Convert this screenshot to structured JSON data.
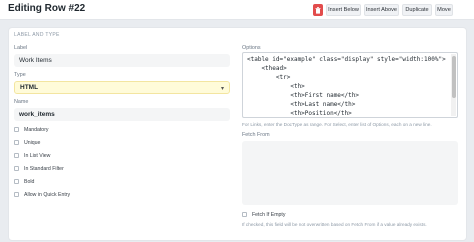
{
  "header": {
    "title": "Editing Row #22",
    "buttons": {
      "insert_below": "Insert Below",
      "insert_above": "Insert Above",
      "duplicate": "Duplicate",
      "move": "Move"
    }
  },
  "section": {
    "title": "LABEL AND TYPE"
  },
  "left": {
    "label": {
      "label": "Label",
      "value": "Work Items"
    },
    "type": {
      "label": "Type",
      "value": "HTML"
    },
    "name": {
      "label": "Name",
      "value": "work_items"
    },
    "checkboxes": [
      {
        "label": "Mandatory",
        "checked": false
      },
      {
        "label": "Unique",
        "checked": false
      },
      {
        "label": "In List View",
        "checked": false
      },
      {
        "label": "In Standard Filter",
        "checked": false
      },
      {
        "label": "Bold",
        "checked": false
      },
      {
        "label": "Allow in Quick Entry",
        "checked": false
      }
    ]
  },
  "right": {
    "options": {
      "label": "Options",
      "lines": [
        "<table id=\"example\" class=\"display\" style=\"width:100%\">",
        "    <thead>",
        "        <tr>",
        "            <th>",
        "            <th>First name</th>",
        "            <th>Last name</th>",
        "            <th>Position</th>"
      ],
      "help": "For Links, enter the DocType as range. For Select, enter list of Options, each on a new line."
    },
    "fetch_from": {
      "label": "Fetch From",
      "value": ""
    },
    "fetch_if_empty": {
      "label": "Fetch If Empty",
      "checked": false,
      "help": "If checked, this field will be not overwritten based on Fetch From if a value already exists."
    }
  },
  "colors": {
    "danger": "#e24c4c",
    "select_bg": "#fffbd9",
    "input_bg": "#f4f5f6"
  },
  "icons": {
    "delete": "trash-icon",
    "dropdown": "chevron-down-icon"
  }
}
